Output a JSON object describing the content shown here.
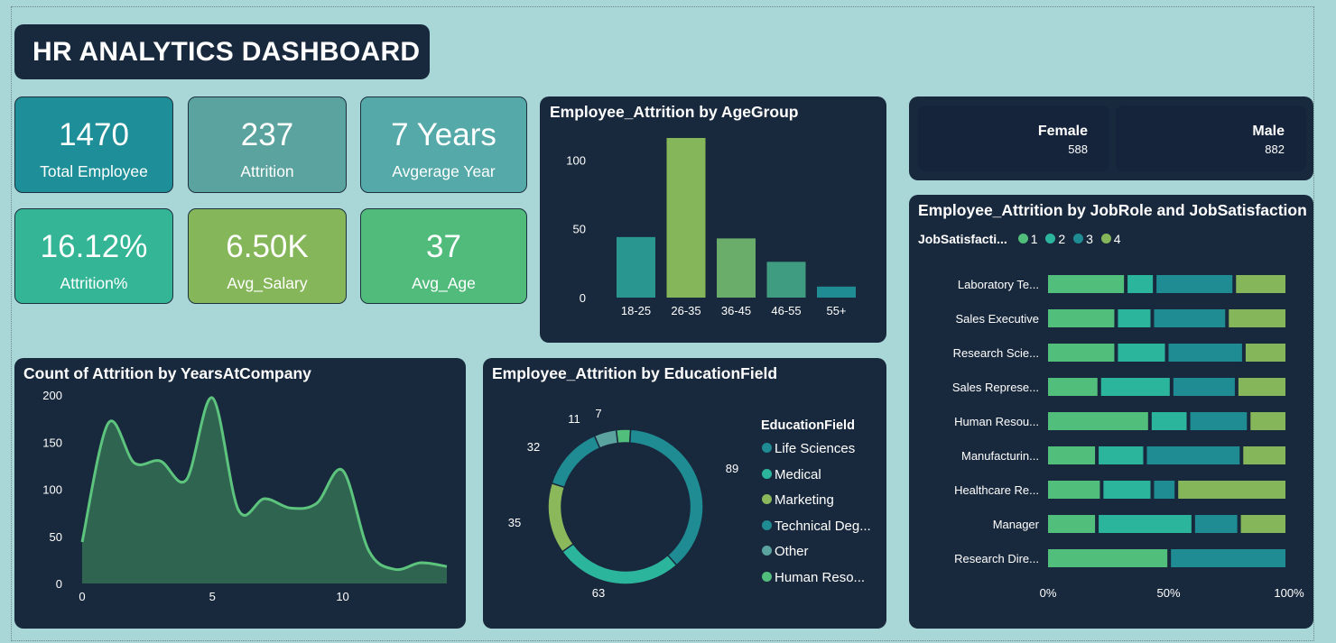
{
  "dashboard": {
    "title": "HR ANALYTICS DASHBOARD"
  },
  "kpis": [
    {
      "value": "1470",
      "label": "Total Employee",
      "color": "#1e8f98"
    },
    {
      "value": "237",
      "label": "Attrition",
      "color": "#5ba39e"
    },
    {
      "value": "7 Years",
      "label": "Avgerage Year",
      "color": "#55a9a9"
    },
    {
      "value": "16.12%",
      "label": "Attrition%",
      "color": "#34b596"
    },
    {
      "value": "6.50K",
      "label": "Avg_Salary",
      "color": "#86b65a"
    },
    {
      "value": "37",
      "label": "Avg_Age",
      "color": "#51bb7c"
    }
  ],
  "gender": {
    "female": {
      "label": "Female",
      "value": "588"
    },
    "male": {
      "label": "Male",
      "value": "882"
    }
  },
  "colors": {
    "teal_dark": "#1f8b92",
    "teal": "#2cb59d",
    "green": "#52be7c",
    "olive_green": "#86b65a",
    "panel_bg": "#19293d",
    "page_bg": "#a9d6d6"
  },
  "age_chart": {
    "title": "Employee_Attrition by AgeGroup",
    "chart_data": {
      "type": "bar",
      "categories": [
        "18-25",
        "26-35",
        "36-45",
        "46-55",
        "55+"
      ],
      "values": [
        44,
        116,
        43,
        26,
        8
      ],
      "ylim": [
        0,
        120
      ],
      "yticks": [
        "0",
        "50",
        "100"
      ],
      "xlabel": "",
      "ylabel": "",
      "bar_colors": [
        "#2a9690",
        "#86b65a",
        "#6aad6a",
        "#3f9c80",
        "#1f8b92"
      ],
      "grid": false
    }
  },
  "years_chart": {
    "title": "Count of Attrition by YearsAtCompany",
    "chart_data": {
      "type": "area",
      "x": [
        0,
        1,
        2,
        3,
        4,
        5,
        6,
        7,
        8,
        9,
        10,
        11,
        12,
        13,
        14
      ],
      "values": [
        44,
        170,
        128,
        130,
        110,
        197,
        78,
        90,
        80,
        85,
        120,
        35,
        15,
        22,
        18
      ],
      "ylim": [
        0,
        200
      ],
      "yticks": [
        "0",
        "50",
        "100",
        "150",
        "200"
      ],
      "xticks": [
        "0",
        "5",
        "10"
      ],
      "xlabel": "",
      "ylabel": "",
      "line_color": "#5dc47e",
      "fill_color": "#2f6450"
    }
  },
  "edu_chart": {
    "title": "Employee_Attrition by EducationField",
    "legend_title": "EducationField",
    "chart_data": {
      "type": "pie",
      "donut": true,
      "categories": [
        "Life Sciences",
        "Medical",
        "Marketing",
        "Technical Deg...",
        "Other",
        "Human Reso..."
      ],
      "values": [
        89,
        63,
        35,
        32,
        11,
        7
      ],
      "labels": [
        "89",
        "63",
        "35",
        "32",
        "11",
        "7"
      ],
      "colors": [
        "#1f8b92",
        "#2cb59d",
        "#8ab85a",
        "#1f8b92",
        "#5ba39e",
        "#52be7c"
      ]
    }
  },
  "job_chart": {
    "title": "Employee_Attrition by JobRole and JobSatisfaction",
    "legend_title": "JobSatisfacti...",
    "legend_items": [
      "1",
      "2",
      "3",
      "4"
    ],
    "xticks": [
      "0%",
      "50%",
      "100%"
    ],
    "chart_data": {
      "type": "bar",
      "orientation": "horizontal",
      "stacked": "100%",
      "categories": [
        "Laboratory Te...",
        "Sales Executive",
        "Research Scie...",
        "Sales Represe...",
        "Human Resou...",
        "Manufacturin...",
        "Healthcare Re...",
        "Manager",
        "Research Dire..."
      ],
      "series": [
        {
          "name": "1",
          "color": "#52be7c",
          "values": [
            33,
            29,
            29,
            22,
            43,
            21,
            23,
            21,
            51
          ]
        },
        {
          "name": "2",
          "color": "#2cb59d",
          "values": [
            12,
            15,
            21,
            30,
            16,
            20,
            21,
            40,
            0
          ]
        },
        {
          "name": "3",
          "color": "#1f8b92",
          "values": [
            33,
            31,
            32,
            27,
            25,
            40,
            10,
            19,
            49
          ]
        },
        {
          "name": "4",
          "color": "#86b65a",
          "values": [
            22,
            25,
            18,
            21,
            16,
            19,
            46,
            20,
            0
          ]
        }
      ],
      "xlim": [
        0,
        100
      ]
    }
  }
}
